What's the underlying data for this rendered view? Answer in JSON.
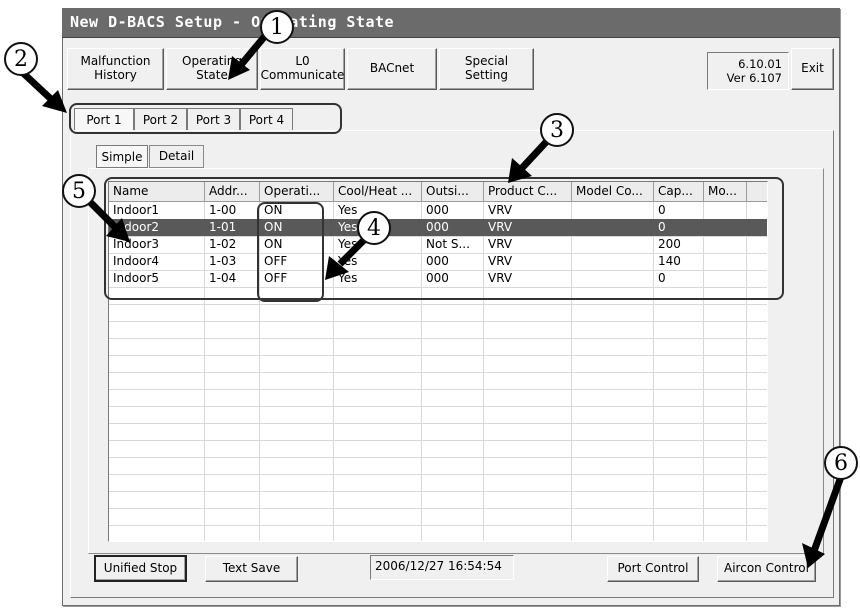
{
  "window": {
    "title": "New D-BACS Setup - Operating State"
  },
  "nav": {
    "malfunction": [
      "Malfunction",
      "History"
    ],
    "operating": [
      "Operating",
      "State"
    ],
    "l0": [
      "L0",
      "Communicate"
    ],
    "bacnet": "BACnet",
    "special": [
      "Special",
      "Setting"
    ],
    "version_line1": "6.10.01",
    "version_line2": "Ver 6.107",
    "exit": "Exit"
  },
  "ports": [
    "Port 1",
    "Port 2",
    "Port 3",
    "Port 4"
  ],
  "views": [
    "Simple",
    "Detail"
  ],
  "table": {
    "columns": [
      "Name",
      "Addr...",
      "Operati...",
      "Cool/Heat ...",
      "Outsi...",
      "Product C...",
      "Model Co...",
      "Cap...",
      "Mo..."
    ],
    "rows": [
      [
        "Indoor1",
        "1-00",
        "ON",
        "Yes",
        "000",
        "VRV",
        "",
        "0",
        ""
      ],
      [
        "Indoor2",
        "1-01",
        "ON",
        "Yes",
        "000",
        "VRV",
        "",
        "0",
        ""
      ],
      [
        "Indoor3",
        "1-02",
        "ON",
        "Yes",
        "Not S...",
        "VRV",
        "",
        "200",
        ""
      ],
      [
        "Indoor4",
        "1-03",
        "OFF",
        "Yes",
        "000",
        "VRV",
        "",
        "140",
        ""
      ],
      [
        "Indoor5",
        "1-04",
        "OFF",
        "Yes",
        "000",
        "VRV",
        "",
        "0",
        ""
      ]
    ],
    "selected_row": 1
  },
  "footer": {
    "unified_stop": "Unified Stop",
    "text_save": "Text Save",
    "timestamp": "2006/12/27 16:54:54",
    "port_control": "Port Control",
    "aircon_control": "Aircon Control"
  },
  "callouts": [
    "1",
    "2",
    "3",
    "4",
    "5",
    "6"
  ],
  "colors": {
    "titlebar": "#6b6b6b",
    "selected_row": "#595959",
    "window_bg": "#f0f0f0"
  }
}
